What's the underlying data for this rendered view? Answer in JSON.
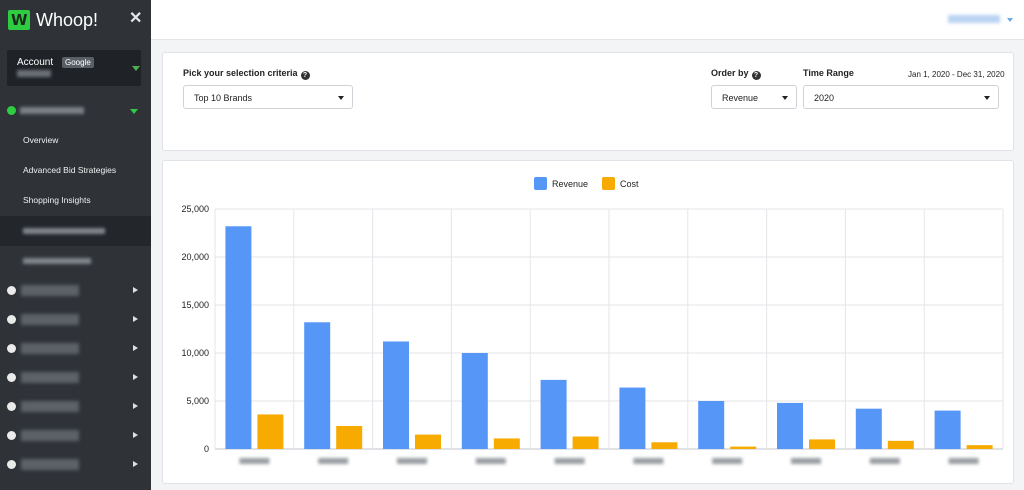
{
  "brand": {
    "name": "Whoop!"
  },
  "sidebar": {
    "account_label": "Account",
    "account_badge": "Google",
    "sub_items": [
      "Overview",
      "Advanced Bid Strategies",
      "Shopping Insights"
    ]
  },
  "criteria": {
    "selection_label": "Pick your selection criteria",
    "selection_value": "Top 10 Brands",
    "order_label": "Order by",
    "order_value": "Revenue",
    "time_label": "Time Range",
    "time_value": "2020",
    "date_range": "Jan 1, 2020 - Dec 31, 2020"
  },
  "colors": {
    "revenue": "#5596f7",
    "cost": "#f7ab00",
    "accent": "#2ecc40"
  },
  "chart_data": {
    "type": "bar",
    "series": [
      {
        "name": "Revenue",
        "values": [
          23200,
          13200,
          11200,
          10000,
          7200,
          6400,
          5000,
          4800,
          4200,
          4000
        ]
      },
      {
        "name": "Cost",
        "values": [
          3600,
          2400,
          1500,
          1100,
          1300,
          700,
          250,
          1000,
          850,
          400
        ]
      }
    ],
    "categories_count": 10,
    "ylim": [
      0,
      25000
    ],
    "yticks": [
      "0",
      "5,000",
      "10,000",
      "15,000",
      "20,000",
      "25,000"
    ],
    "grid": true,
    "legend_position": "top-center"
  }
}
